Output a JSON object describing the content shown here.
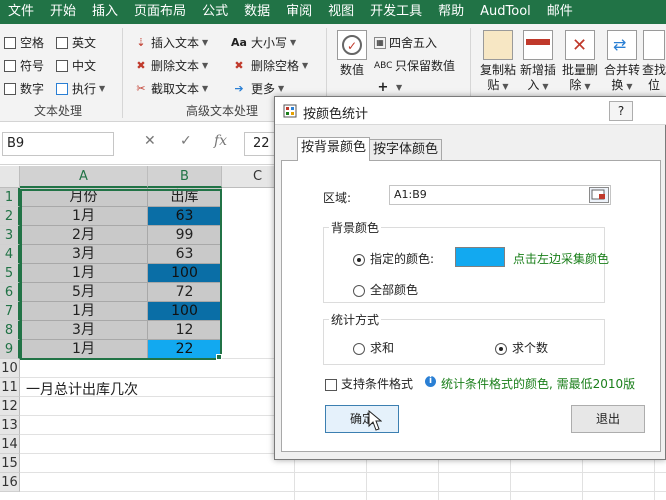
{
  "menubar": {
    "items": [
      "文件",
      "开始",
      "插入",
      "页面布局",
      "公式",
      "数据",
      "审阅",
      "视图",
      "开发工具",
      "帮助",
      "AudTool",
      "邮件"
    ]
  },
  "ribbon": {
    "text_group": {
      "checkboxes": [
        "空格",
        "英文",
        "符号",
        "中文",
        "数字",
        "执行"
      ],
      "label": "文本处理"
    },
    "advanced_group": {
      "items": [
        "插入文本",
        "删除文本",
        "截取文本",
        "大小写",
        "删除空格",
        "更多"
      ],
      "label": "高级文本处理"
    },
    "number_group": {
      "big_label": "数值",
      "items": [
        "四舍五入",
        "只保留数值"
      ]
    },
    "right_buttons": [
      {
        "line1": "复制粘",
        "line2": "贴"
      },
      {
        "line1": "新增插",
        "line2": "入"
      },
      {
        "line1": "批量删",
        "line2": "除"
      },
      {
        "line1": "合并转",
        "line2": "换"
      },
      {
        "line1": "查找",
        "line2": "位"
      }
    ]
  },
  "formula_bar": {
    "name_box": "B9",
    "cancel": "✕",
    "enter": "✓",
    "fx": "fx",
    "value": "22"
  },
  "sheet": {
    "columns": [
      "A",
      "B",
      "C"
    ],
    "rows": [
      "1",
      "2",
      "3",
      "4",
      "5",
      "6",
      "7",
      "8",
      "9",
      "10",
      "11",
      "12",
      "13",
      "14",
      "15",
      "16"
    ],
    "table": [
      {
        "a": "月份",
        "b": "出库"
      },
      {
        "a": "1月",
        "b": "63"
      },
      {
        "a": "2月",
        "b": "99"
      },
      {
        "a": "3月",
        "b": "63"
      },
      {
        "a": "1月",
        "b": "100"
      },
      {
        "a": "5月",
        "b": "72"
      },
      {
        "a": "1月",
        "b": "100"
      },
      {
        "a": "3月",
        "b": "12"
      },
      {
        "a": "1月",
        "b": "22"
      }
    ],
    "note": "一月总计出库几次",
    "colors": {
      "dark_blue": "#0a6ea6",
      "light_blue": "#12a9f0",
      "gray": "#c9c9c9",
      "accent": "#217346"
    }
  },
  "dialog": {
    "title": "按颜色统计",
    "help": "?",
    "tabs": [
      "按背景颜色",
      "按字体颜色"
    ],
    "area_label": "区域:",
    "area_value": "A1:B9",
    "bg_group": {
      "legend": "背景颜色",
      "opt_specified": "指定的颜色:",
      "opt_all": "全部颜色",
      "hint": "点击左边采集颜色",
      "swatch_color": "#12a9f0"
    },
    "stat_group": {
      "legend": "统计方式",
      "opt_sum": "求和",
      "opt_count": "求个数"
    },
    "support_cf": "支持条件格式",
    "support_cf_hint": "统计条件格式的颜色, 需最低2010版",
    "ok": "确定",
    "exit": "退出"
  }
}
